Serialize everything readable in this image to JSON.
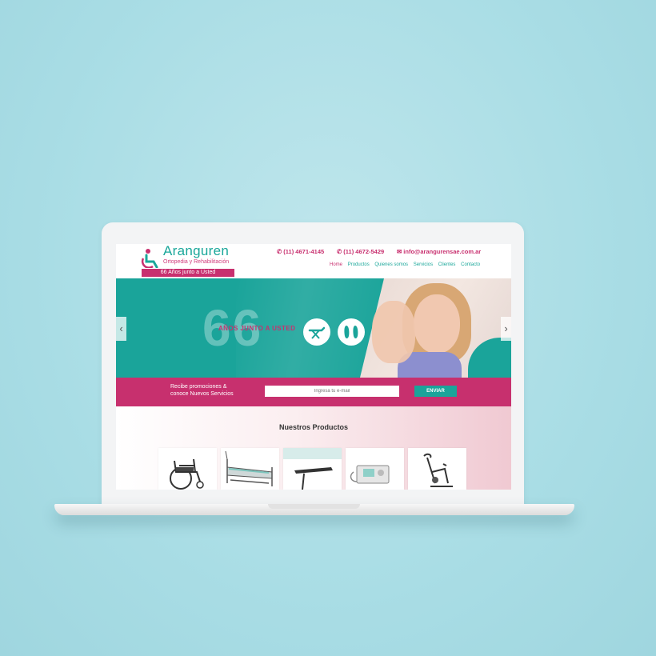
{
  "brand": {
    "name": "Aranguren",
    "subtitle": "Ortopedia y Rehabilitación",
    "tagline": "66 Años junto a Usted",
    "accent": "#1aa49a",
    "accent2": "#c8306f"
  },
  "contact": {
    "phone1": "(11) 4671-4145",
    "phone2": "(11) 4672-5429",
    "email": "info@arangurensae.com.ar"
  },
  "nav": {
    "items": [
      "Home",
      "Productos",
      "Quienes somos",
      "Servicios",
      "Clientes",
      "Contacto"
    ],
    "active": "Home"
  },
  "hero": {
    "number": "66",
    "text": "AÑOS JUNTO A USTED",
    "prev_arrow": "‹",
    "next_arrow": "›",
    "icons": [
      "massage-table-icon",
      "orthopedic-insoles-icon"
    ]
  },
  "newsletter": {
    "line1": "Recibe promociones &",
    "line2": "conoce Nuevos Servicios",
    "placeholder": "Ingresá tu e-mail",
    "button": "ENVIAR"
  },
  "products": {
    "title": "Nuestros Productos",
    "items": [
      "wheelchair",
      "hospital-bed",
      "overbed-table",
      "medical-equipment",
      "exercise-bike"
    ]
  }
}
